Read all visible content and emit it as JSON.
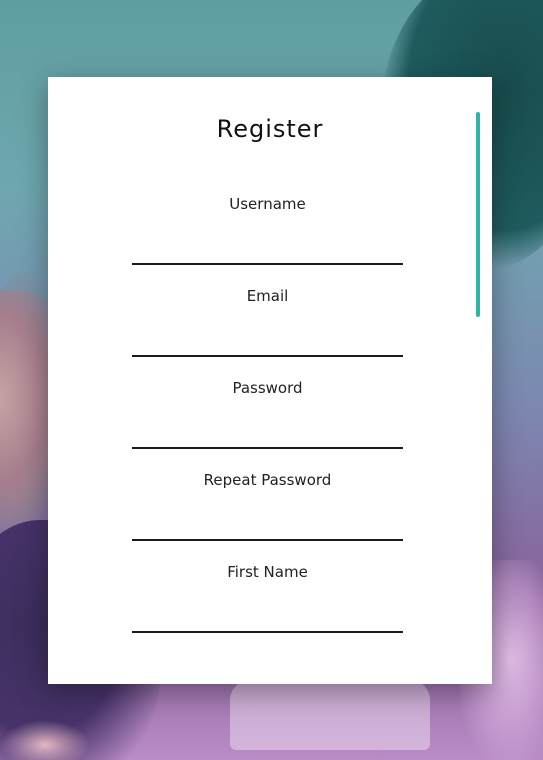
{
  "form": {
    "title": "Register",
    "fields": [
      {
        "label": "Username",
        "value": ""
      },
      {
        "label": "Email",
        "value": ""
      },
      {
        "label": "Password",
        "value": ""
      },
      {
        "label": "Repeat Password",
        "value": ""
      },
      {
        "label": "First Name",
        "value": ""
      }
    ]
  },
  "colors": {
    "accent": "#2fb5a8",
    "card": "#ffffff",
    "underline": "#1a1a1a"
  }
}
